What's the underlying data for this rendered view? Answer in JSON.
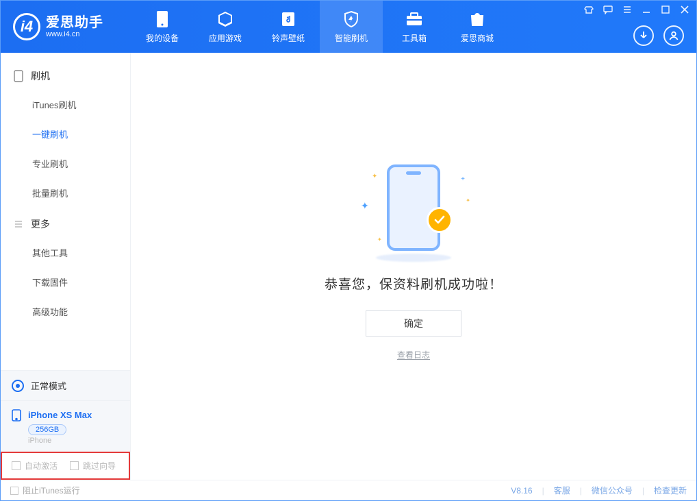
{
  "brand": {
    "cn": "爱思助手",
    "en": "www.i4.cn"
  },
  "tabs": [
    {
      "label": "我的设备",
      "icon": "device-icon"
    },
    {
      "label": "应用游戏",
      "icon": "cube-icon"
    },
    {
      "label": "铃声壁纸",
      "icon": "note-icon"
    },
    {
      "label": "智能刷机",
      "icon": "shield-icon"
    },
    {
      "label": "工具箱",
      "icon": "toolbox-icon"
    },
    {
      "label": "爱思商城",
      "icon": "bag-icon"
    }
  ],
  "active_tab_index": 3,
  "sidebar": {
    "group1_title": "刷机",
    "group1_items": [
      "iTunes刷机",
      "一键刷机",
      "专业刷机",
      "批量刷机"
    ],
    "group1_active_index": 1,
    "group2_title": "更多",
    "group2_items": [
      "其他工具",
      "下载固件",
      "高级功能"
    ]
  },
  "mode_label": "正常模式",
  "device": {
    "name": "iPhone XS Max",
    "storage": "256GB",
    "type": "iPhone"
  },
  "checkboxes": {
    "auto_activate": "自动激活",
    "skip_guide": "跳过向导"
  },
  "result": {
    "message": "恭喜您，保资料刷机成功啦！",
    "ok_button": "确定",
    "log_link": "查看日志"
  },
  "statusbar": {
    "block_itunes": "阻止iTunes运行",
    "version": "V8.16",
    "support": "客服",
    "wechat": "微信公众号",
    "update": "检查更新"
  }
}
